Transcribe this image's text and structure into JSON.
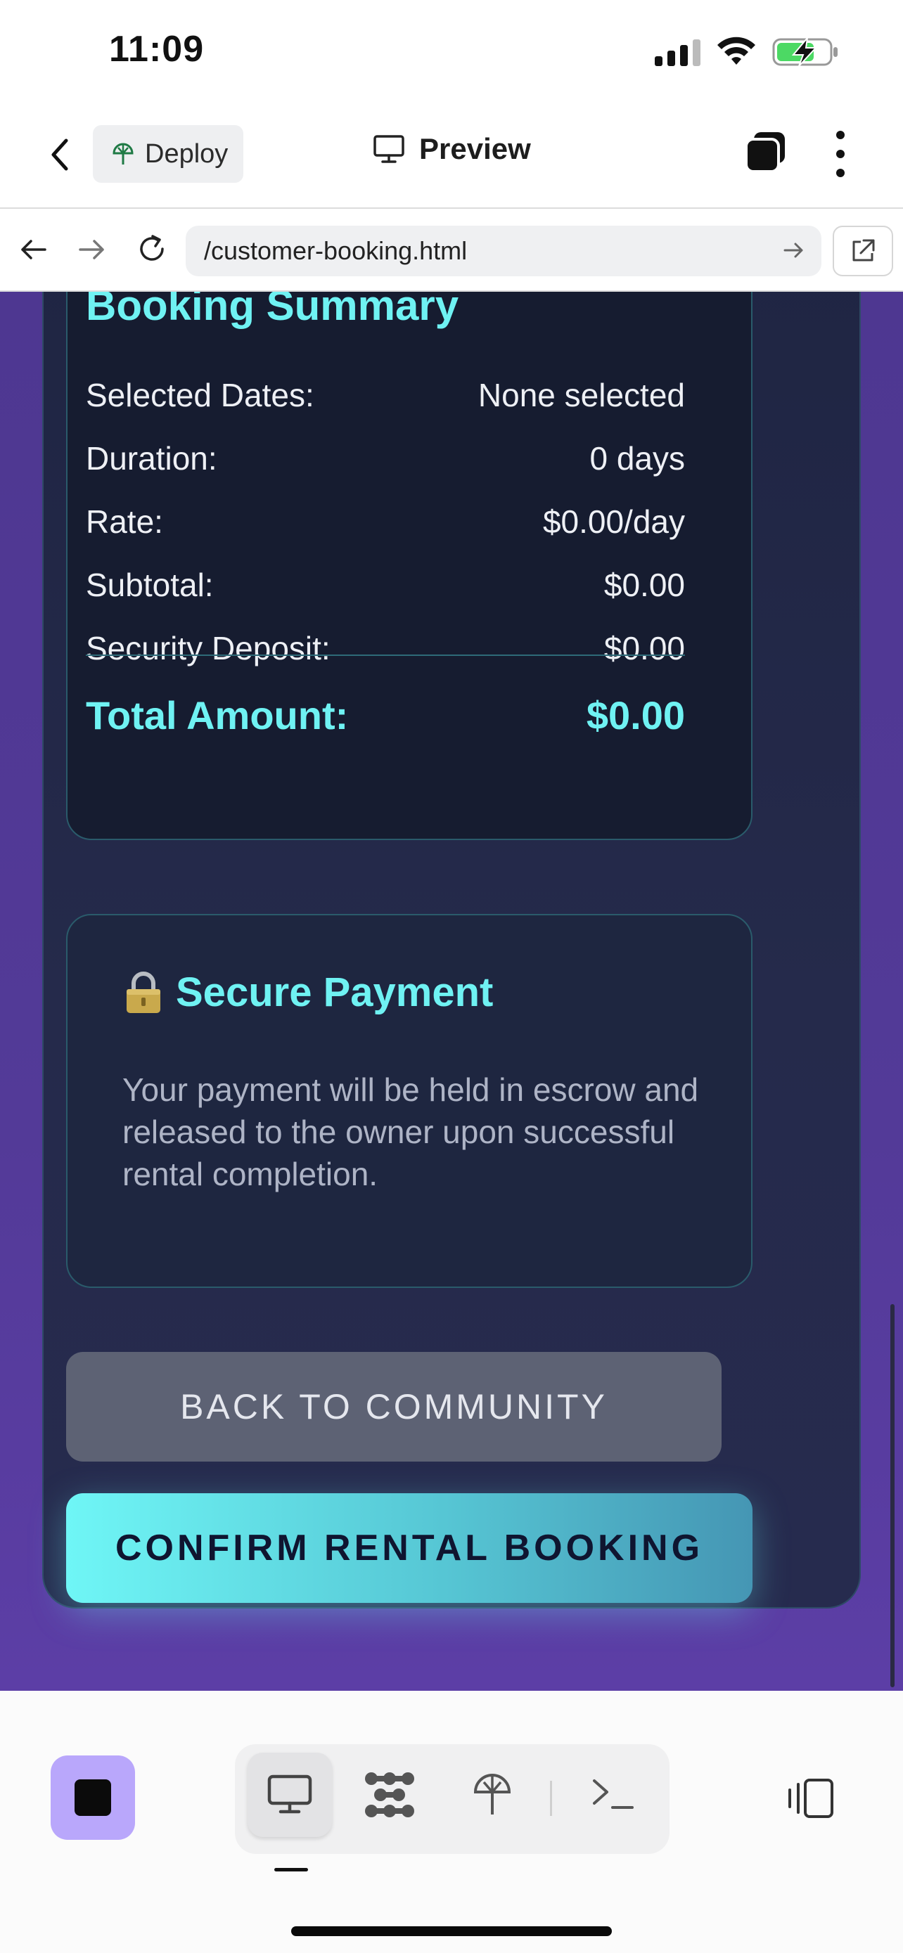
{
  "status_bar": {
    "time": "11:09"
  },
  "header": {
    "deploy_label": "Deploy",
    "title": "Preview"
  },
  "browser": {
    "url": "/customer-booking.html"
  },
  "booking_summary": {
    "title": "Booking Summary",
    "rows": [
      {
        "label": "Selected Dates:",
        "value": "None selected"
      },
      {
        "label": "Duration:",
        "value": "0 days"
      },
      {
        "label": "Rate:",
        "value": "$0.00/day"
      },
      {
        "label": "Subtotal:",
        "value": "$0.00"
      },
      {
        "label": "Security Deposit:",
        "value": "$0.00"
      }
    ],
    "total_label": "Total Amount:",
    "total_value": "$0.00"
  },
  "secure_payment": {
    "icon": "lock-icon",
    "title": "Secure Payment",
    "text": "Your payment will be held in escrow and released to the owner upon successful rental completion."
  },
  "actions": {
    "back_label": "BACK TO COMMUNITY",
    "confirm_label": "CONFIRM RENTAL BOOKING"
  },
  "colors": {
    "accent": "#6ff2f3",
    "page_bg": "#523a97",
    "card_bg": "#161c30",
    "stop_button": "#b9a7fb"
  }
}
